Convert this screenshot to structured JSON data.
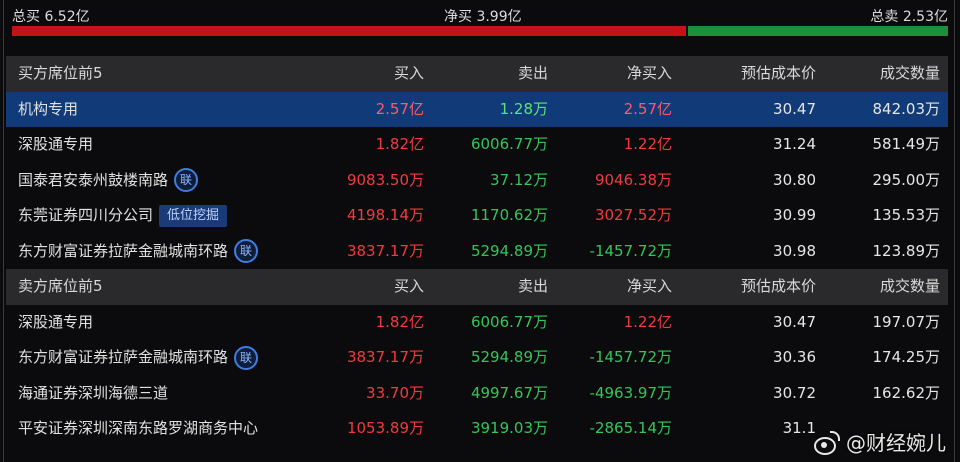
{
  "summary": {
    "total_buy": "总买 6.52亿",
    "net_buy": "净买 3.99亿",
    "total_sell": "总卖 2.53亿",
    "buy_ratio": 0.72
  },
  "columns": [
    "买入",
    "卖出",
    "净买入",
    "预估成本价",
    "成交数量"
  ],
  "buy_section": {
    "title": "买方席位前5",
    "rows": [
      {
        "name": "机构专用",
        "buy": "2.57亿",
        "sell": "1.28万",
        "net": "2.57亿",
        "net_sign": "pos",
        "cost": "30.47",
        "volume": "842.03万",
        "badge": "",
        "tag": ""
      },
      {
        "name": "深股通专用",
        "buy": "1.82亿",
        "sell": "6006.77万",
        "net": "1.22亿",
        "net_sign": "pos",
        "cost": "31.24",
        "volume": "581.49万",
        "badge": "",
        "tag": ""
      },
      {
        "name": "国泰君安泰州鼓楼南路",
        "buy": "9083.50万",
        "sell": "37.12万",
        "net": "9046.38万",
        "net_sign": "pos",
        "cost": "30.80",
        "volume": "295.00万",
        "badge": "联",
        "tag": ""
      },
      {
        "name": "东莞证券四川分公司",
        "buy": "4198.14万",
        "sell": "1170.62万",
        "net": "3027.52万",
        "net_sign": "pos",
        "cost": "30.99",
        "volume": "135.53万",
        "badge": "",
        "tag": "低位挖掘"
      },
      {
        "name": "东方财富证券拉萨金融城南环路",
        "buy": "3837.17万",
        "sell": "5294.89万",
        "net": "-1457.72万",
        "net_sign": "neg",
        "cost": "30.98",
        "volume": "123.89万",
        "badge": "联",
        "tag": ""
      }
    ]
  },
  "sell_section": {
    "title": "卖方席位前5",
    "rows": [
      {
        "name": "深股通专用",
        "buy": "1.82亿",
        "sell": "6006.77万",
        "net": "1.22亿",
        "net_sign": "pos",
        "cost": "30.47",
        "volume": "197.07万",
        "badge": "",
        "tag": ""
      },
      {
        "name": "东方财富证券拉萨金融城南环路",
        "buy": "3837.17万",
        "sell": "5294.89万",
        "net": "-1457.72万",
        "net_sign": "neg",
        "cost": "30.36",
        "volume": "174.25万",
        "badge": "联",
        "tag": ""
      },
      {
        "name": "海通证券深圳海德三道",
        "buy": "33.70万",
        "sell": "4997.67万",
        "net": "-4963.97万",
        "net_sign": "neg",
        "cost": "30.72",
        "volume": "162.62万",
        "badge": "",
        "tag": ""
      },
      {
        "name": "平安证券深圳深南东路罗湖商务中心",
        "buy": "1053.89万",
        "sell": "3919.03万",
        "net": "-2865.14万",
        "net_sign": "neg",
        "cost": "31.1",
        "volume": "",
        "badge": "",
        "tag": ""
      }
    ]
  },
  "watermark": "@财经婉儿",
  "colors": {
    "red": "#f23a3f",
    "green": "#34c55a",
    "selected": "#113a78",
    "header": "#2a2a2c"
  }
}
